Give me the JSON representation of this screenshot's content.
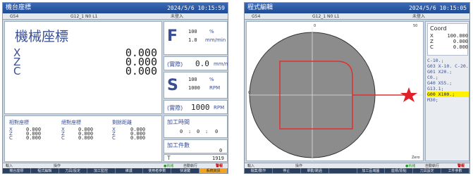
{
  "left": {
    "title": "機台座標",
    "datetime": "2024/5/6  10:15:59",
    "status": {
      "gcode": "G54",
      "program": "G12_1 N0 L1",
      "login": "未登入"
    },
    "machine": {
      "heading": "機械座標",
      "axes": [
        {
          "name": "X",
          "value": "0.000"
        },
        {
          "name": "Z",
          "value": "0.000"
        },
        {
          "name": "C",
          "value": "0.000"
        }
      ]
    },
    "feed": {
      "letter": "F",
      "v1": "100",
      "u1": "%",
      "v2": "1.0",
      "u2": "mm/min"
    },
    "feed_actual": {
      "label": "(實際)",
      "value": "0.0",
      "unit": "mm/min"
    },
    "spindle": {
      "letter": "S",
      "v1": "100",
      "u1": "%",
      "v2": "1000",
      "u2": "RPM"
    },
    "spindle_actual": {
      "label": "(實際)",
      "value": "1000",
      "unit": "RPM"
    },
    "cycle_time": {
      "label": "加工時間",
      "h": "0",
      "m": "0",
      "s": "0"
    },
    "part_count": {
      "label": "加工件數",
      "value": "0"
    },
    "tool": {
      "label": "T",
      "value": "1919"
    },
    "coords": {
      "headers": [
        "相對座標",
        "絕對座標",
        "剩餘距離"
      ],
      "letters": [
        "X",
        "Z",
        "C"
      ],
      "relative": [
        "0.000",
        "0.000",
        "0.000"
      ],
      "absolute": [
        "0.000",
        "0.000",
        "0.000"
      ],
      "remaining": [
        "0.000",
        "0.000",
        "0.000"
      ]
    },
    "bottom": {
      "input": "輸入",
      "op": "操作",
      "state": "●就緒",
      "exec": "自動執行",
      "alarm": "警報"
    },
    "softkeys": [
      "機台座標",
      "程式編輯",
      "刀具/設定",
      "加工監控",
      "維護",
      "使用者參數",
      "快速鍵",
      "系統資訊"
    ]
  },
  "right": {
    "title": "程式編輯",
    "datetime": "2024/5/6  10:15:05",
    "status": {
      "gcode": "G54",
      "program": "G12_1 N0 L1",
      "login": "未登入"
    },
    "graph": {
      "top_tick": "0",
      "top_right_tick": "50",
      "left_tick": "0",
      "bottom_right": "Zero"
    },
    "coord_box": {
      "title": "Coord",
      "rows": [
        {
          "axis": "X",
          "value": "100.000"
        },
        {
          "axis": "Z",
          "value": "0.000"
        },
        {
          "axis": "C",
          "value": "0.000"
        }
      ]
    },
    "program_lines": [
      "C-10.;",
      "G03 X-10. C-20. R10.;",
      "G01 X20.;",
      "C0.;",
      "G40 X55.;",
      "G13.1;",
      "G00 X100.;",
      "M30;"
    ],
    "current_line": 6,
    "bottom": {
      "input": "輸入",
      "op": "操作",
      "state": "●就緒",
      "exec": "自動執行",
      "alarm": "警報"
    },
    "softkeys": [
      "檔案/動作",
      "停止",
      "單動/跳過",
      "",
      "加工區域圖",
      "座標/原點",
      "刀具設定",
      "工件參數"
    ]
  }
}
